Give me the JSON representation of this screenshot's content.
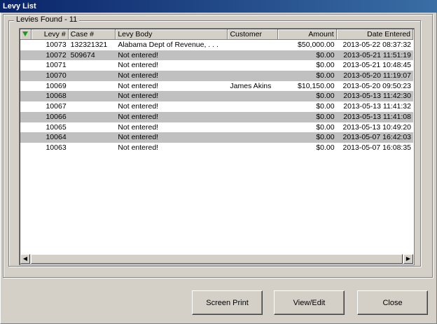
{
  "window": {
    "title": "Levy List"
  },
  "group": {
    "label": "Levies Found - 11"
  },
  "table": {
    "columns": [
      "Levy #",
      "Case #",
      "Levy Body",
      "Customer",
      "Amount",
      "Date Entered"
    ],
    "rows": [
      [
        "10073",
        "132321321",
        "Alabama Dept of Revenue, . . .",
        "",
        "$50,000.00",
        "2013-05-22 08:37:32"
      ],
      [
        "10072",
        "509674",
        "Not entered!",
        "",
        "$0.00",
        "2013-05-21 11:51:19"
      ],
      [
        "10071",
        "",
        "Not entered!",
        "",
        "$0.00",
        "2013-05-21 10:48:45"
      ],
      [
        "10070",
        "",
        "Not entered!",
        "",
        "$0.00",
        "2013-05-20 11:19:07"
      ],
      [
        "10069",
        "",
        "Not entered!",
        "James Akins",
        "$10,150.00",
        "2013-05-20 09:50:23"
      ],
      [
        "10068",
        "",
        "Not entered!",
        "",
        "$0.00",
        "2013-05-13 11:42:30"
      ],
      [
        "10067",
        "",
        "Not entered!",
        "",
        "$0.00",
        "2013-05-13 11:41:32"
      ],
      [
        "10066",
        "",
        "Not entered!",
        "",
        "$0.00",
        "2013-05-13 11:41:08"
      ],
      [
        "10065",
        "",
        "Not entered!",
        "",
        "$0.00",
        "2013-05-13 10:49:20"
      ],
      [
        "10064",
        "",
        "Not entered!",
        "",
        "$0.00",
        "2013-05-07 16:42:03"
      ],
      [
        "10063",
        "",
        "Not entered!",
        "",
        "$0.00",
        "2013-05-07 16:08:35"
      ]
    ]
  },
  "buttons": {
    "screen_print": "Screen Print",
    "view_edit": "View/Edit",
    "close": "Close"
  },
  "icons": {
    "sort": "sort-down-arrow-icon",
    "scroll_left": "scroll-left-icon",
    "scroll_right": "scroll-right-icon"
  },
  "colors": {
    "titlebar": "#0a246a",
    "row_alt": "#c0c0c0",
    "sort_arrow": "#1a9c1a"
  }
}
